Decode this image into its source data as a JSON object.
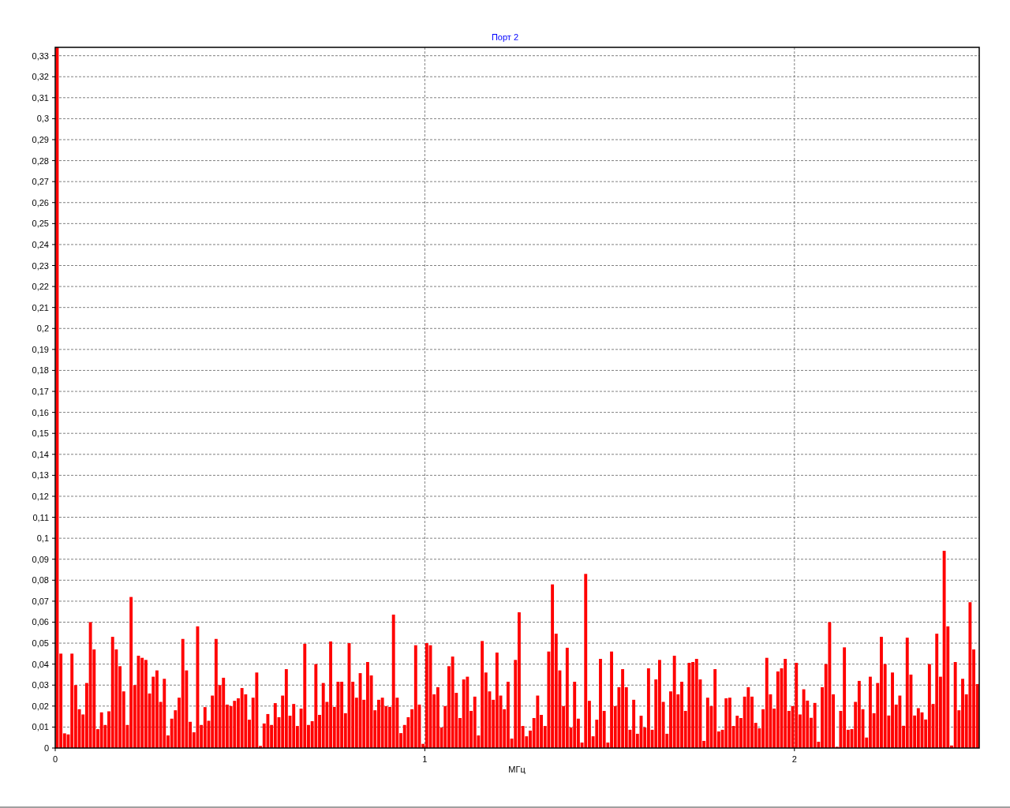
{
  "chart": {
    "chart_data": {
      "type": "bar",
      "title": "Порт 2",
      "xlabel": "МГц",
      "xlim": [
        0,
        2.5
      ],
      "ylim": [
        0,
        0.334
      ],
      "grid": true,
      "x": [
        0,
        0.01,
        0.02,
        0.03,
        0.04,
        0.05,
        0.06,
        0.07,
        0.08,
        0.09,
        0.1,
        0.11,
        0.12,
        0.13,
        0.14,
        0.15,
        0.16,
        0.17,
        0.18,
        0.19,
        0.2,
        0.21,
        0.22,
        0.23,
        0.24,
        0.25,
        0.26,
        0.27,
        0.28,
        0.29,
        0.3,
        0.31,
        0.32,
        0.33,
        0.34,
        0.35,
        0.36,
        0.37,
        0.38,
        0.39,
        0.4,
        0.41,
        0.42,
        0.43,
        0.44,
        0.45,
        0.46,
        0.47,
        0.48,
        0.49,
        0.5,
        0.51,
        0.52,
        0.53,
        0.54,
        0.55,
        0.56,
        0.57,
        0.58,
        0.59,
        0.6,
        0.61,
        0.62,
        0.63,
        0.64,
        0.65,
        0.66,
        0.67,
        0.68,
        0.69,
        0.7,
        0.71,
        0.72,
        0.73,
        0.74,
        0.75,
        0.76,
        0.77,
        0.78,
        0.79,
        0.8,
        0.81,
        0.82,
        0.83,
        0.84,
        0.85,
        0.86,
        0.87,
        0.88,
        0.89,
        0.9,
        0.91,
        0.92,
        0.93,
        0.94,
        0.95,
        0.96,
        0.97,
        0.98,
        0.99,
        1,
        1.01,
        1.02,
        1.03,
        1.04,
        1.05,
        1.06,
        1.07,
        1.08,
        1.09,
        1.1,
        1.11,
        1.12,
        1.13,
        1.14,
        1.15,
        1.16,
        1.17,
        1.18,
        1.19,
        1.2,
        1.21,
        1.22,
        1.23,
        1.24,
        1.25,
        1.26,
        1.27,
        1.28,
        1.29,
        1.3,
        1.31,
        1.32,
        1.33,
        1.34,
        1.35,
        1.36,
        1.37,
        1.38,
        1.39,
        1.4,
        1.41,
        1.42,
        1.43,
        1.44,
        1.45,
        1.46,
        1.47,
        1.48,
        1.49,
        1.5,
        1.51,
        1.52,
        1.53,
        1.54,
        1.55,
        1.56,
        1.57,
        1.58,
        1.59,
        1.6,
        1.61,
        1.62,
        1.63,
        1.64,
        1.65,
        1.66,
        1.67,
        1.68,
        1.69,
        1.7,
        1.71,
        1.72,
        1.73,
        1.74,
        1.75,
        1.76,
        1.77,
        1.78,
        1.79,
        1.8,
        1.81,
        1.82,
        1.83,
        1.84,
        1.85,
        1.86,
        1.87,
        1.88,
        1.89,
        1.9,
        1.91,
        1.92,
        1.93,
        1.94,
        1.95,
        1.96,
        1.97,
        1.98,
        1.99,
        2,
        2.01,
        2.02,
        2.03,
        2.04,
        2.05,
        2.06,
        2.07,
        2.08,
        2.09,
        2.1,
        2.11,
        2.12,
        2.13,
        2.14,
        2.15,
        2.16,
        2.17,
        2.18,
        2.19,
        2.2,
        2.21,
        2.22,
        2.23,
        2.24,
        2.25,
        2.26,
        2.27,
        2.28,
        2.29,
        2.3,
        2.31,
        2.32,
        2.33,
        2.34,
        2.35,
        2.36,
        2.37,
        2.38,
        2.39,
        2.4,
        2.41,
        2.42,
        2.43,
        2.44,
        2.45,
        2.46,
        2.47,
        2.48,
        2.49
      ],
      "xticks": [
        {
          "value": 0,
          "label": "0"
        },
        {
          "value": 1,
          "label": "1"
        },
        {
          "value": 2,
          "label": "2"
        }
      ],
      "yticks": [
        {
          "value": 0,
          "label": "0"
        },
        {
          "value": 0.01,
          "label": "0,01"
        },
        {
          "value": 0.02,
          "label": "0,02"
        },
        {
          "value": 0.03,
          "label": "0,03"
        },
        {
          "value": 0.04,
          "label": "0,04"
        },
        {
          "value": 0.05,
          "label": "0,05"
        },
        {
          "value": 0.06,
          "label": "0,06"
        },
        {
          "value": 0.07,
          "label": "0,07"
        },
        {
          "value": 0.08,
          "label": "0,08"
        },
        {
          "value": 0.09,
          "label": "0,09"
        },
        {
          "value": 0.1,
          "label": "0,1"
        },
        {
          "value": 0.11,
          "label": "0,11"
        },
        {
          "value": 0.12,
          "label": "0,12"
        },
        {
          "value": 0.13,
          "label": "0,13"
        },
        {
          "value": 0.14,
          "label": "0,14"
        },
        {
          "value": 0.15,
          "label": "0,15"
        },
        {
          "value": 0.16,
          "label": "0,16"
        },
        {
          "value": 0.17,
          "label": "0,17"
        },
        {
          "value": 0.18,
          "label": "0,18"
        },
        {
          "value": 0.19,
          "label": "0,19"
        },
        {
          "value": 0.2,
          "label": "0,2"
        },
        {
          "value": 0.21,
          "label": "0,21"
        },
        {
          "value": 0.22,
          "label": "0,22"
        },
        {
          "value": 0.23,
          "label": "0,23"
        },
        {
          "value": 0.24,
          "label": "0,24"
        },
        {
          "value": 0.25,
          "label": "0,25"
        },
        {
          "value": 0.26,
          "label": "0,26"
        },
        {
          "value": 0.27,
          "label": "0,27"
        },
        {
          "value": 0.28,
          "label": "0,28"
        },
        {
          "value": 0.29,
          "label": "0,29"
        },
        {
          "value": 0.3,
          "label": "0,3"
        },
        {
          "value": 0.31,
          "label": "0,31"
        },
        {
          "value": 0.32,
          "label": "0,32"
        },
        {
          "value": 0.33,
          "label": "0,33"
        }
      ],
      "series": [
        {
          "color": "#ff0000",
          "values": [
            0.334,
            0.045,
            0.007,
            0.0065,
            0.045,
            0.03,
            0.0185,
            0.016,
            0.031,
            0.06,
            0.047,
            0.009,
            0.017,
            0.011,
            0.0175,
            0.053,
            0.047,
            0.039,
            0.027,
            0.011,
            0.072,
            0.03,
            0.044,
            0.043,
            0.042,
            0.026,
            0.034,
            0.037,
            0.022,
            0.033,
            0.006,
            0.014,
            0.018,
            0.024,
            0.052,
            0.037,
            0.0125,
            0.0075,
            0.058,
            0.011,
            0.0195,
            0.013,
            0.025,
            0.052,
            0.03,
            0.0335,
            0.0207,
            0.02,
            0.0225,
            0.0237,
            0.0286,
            0.0256,
            0.0135,
            0.024,
            0.036,
            0.001,
            0.0117,
            0.0162,
            0.011,
            0.0214,
            0.0147,
            0.025,
            0.0376,
            0.0154,
            0.021,
            0.0105,
            0.0188,
            0.0497,
            0.011,
            0.0128,
            0.04,
            0.0158,
            0.031,
            0.022,
            0.0508,
            0.0196,
            0.0316,
            0.0316,
            0.0166,
            0.05,
            0.0316,
            0.024,
            0.0357,
            0.023,
            0.041,
            0.0346,
            0.018,
            0.023,
            0.024,
            0.02,
            0.0196,
            0.0636,
            0.024,
            0.0071,
            0.011,
            0.0147,
            0.0185,
            0.049,
            0.0207,
            0.002,
            0.05,
            0.049,
            0.0256,
            0.029,
            0.0098,
            0.02,
            0.039,
            0.0436,
            0.0263,
            0.0143,
            0.0327,
            0.034,
            0.0177,
            0.0245,
            0.006,
            0.051,
            0.036,
            0.027,
            0.023,
            0.0455,
            0.025,
            0.0185,
            0.0316,
            0.0045,
            0.042,
            0.0647,
            0.0105,
            0.0056,
            0.0083,
            0.0143,
            0.025,
            0.0158,
            0.0105,
            0.046,
            0.078,
            0.0545,
            0.037,
            0.02,
            0.0478,
            0.0098,
            0.0316,
            0.014,
            0.0026,
            0.083,
            0.0225,
            0.0056,
            0.0135,
            0.0425,
            0.0177,
            0.0026,
            0.046,
            0.02,
            0.029,
            0.0376,
            0.029,
            0.0087,
            0.023,
            0.0068,
            0.0154,
            0.0098,
            0.038,
            0.0087,
            0.0327,
            0.042,
            0.022,
            0.0068,
            0.027,
            0.044,
            0.0256,
            0.0316,
            0.0177,
            0.0406,
            0.041,
            0.0425,
            0.0327,
            0.0034,
            0.024,
            0.02,
            0.0376,
            0.0079,
            0.0087,
            0.0237,
            0.024,
            0.0105,
            0.0154,
            0.0143,
            0.0245,
            0.029,
            0.0245,
            0.012,
            0.0094,
            0.0185,
            0.043,
            0.0256,
            0.0188,
            0.0365,
            0.038,
            0.0425,
            0.0177,
            0.02,
            0.0406,
            0.016,
            0.028,
            0.0226,
            0.0144,
            0.0215,
            0.003,
            0.029,
            0.04,
            0.06,
            0.0256,
            0.0006,
            0.0177,
            0.048,
            0.0087,
            0.009,
            0.022,
            0.032,
            0.0185,
            0.005,
            0.034,
            0.0166,
            0.031,
            0.053,
            0.04,
            0.0155,
            0.036,
            0.0207,
            0.025,
            0.0106,
            0.0526,
            0.035,
            0.0155,
            0.019,
            0.017,
            0.0136,
            0.04,
            0.021,
            0.0545,
            0.034,
            0.094,
            0.058,
            0.0012,
            0.041,
            0.018,
            0.033,
            0.0256,
            0.0695,
            0.047,
            0.0305
          ]
        }
      ]
    }
  }
}
